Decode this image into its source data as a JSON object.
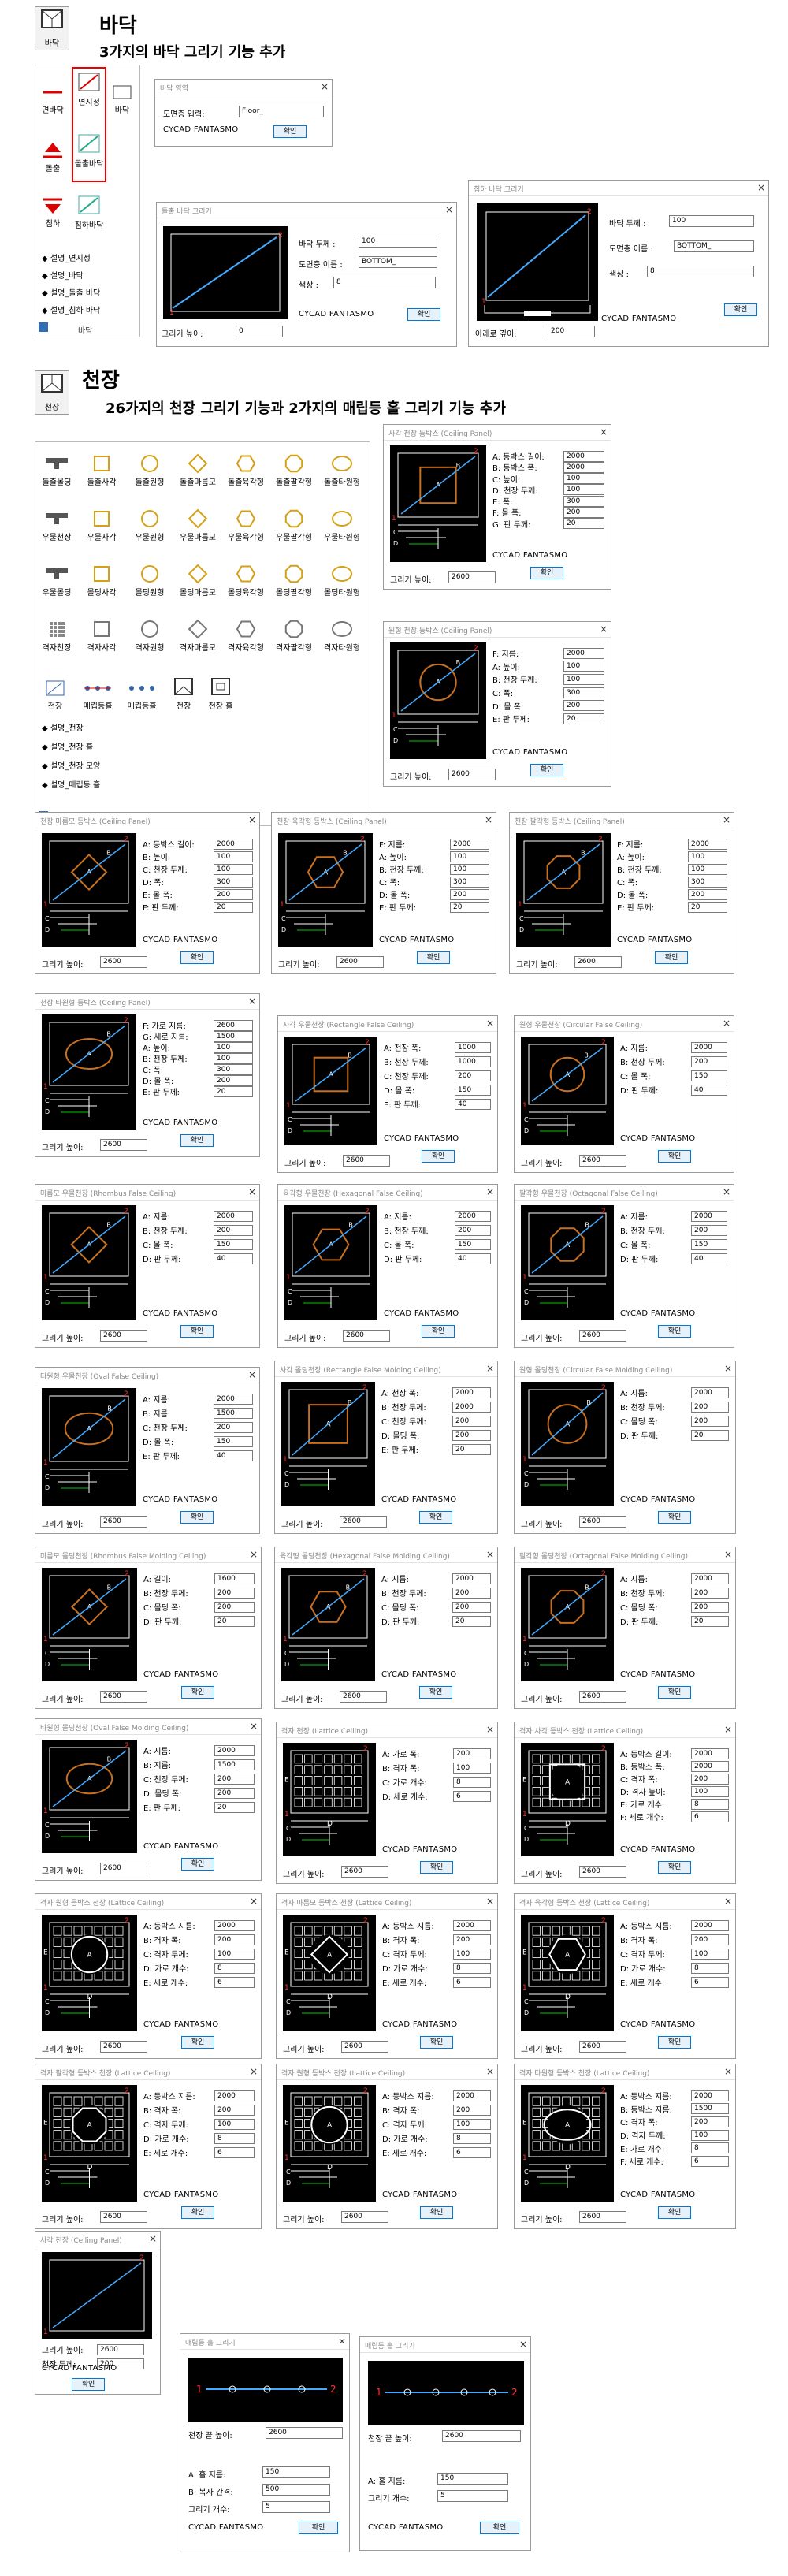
{
  "floor": {
    "icon_label": "바닥",
    "title": "바닥",
    "subtitle": "3가지의 바닥 그리기 기능 추가",
    "tools": [
      {
        "label": "면바닥"
      },
      {
        "label": "면지정"
      },
      {
        "label": "바닥"
      },
      {
        "label": "돌출"
      },
      {
        "label": "돌출바닥"
      },
      {
        "label": "침하"
      },
      {
        "label": "침하바닥"
      }
    ],
    "menu": [
      "설명_면지정",
      "설명_바닥",
      "설명_돌출 바닥",
      "설명_침하 바닥"
    ],
    "footer": "바닥",
    "dialog_small": {
      "title": "바닥 영역",
      "field_label": "도면층 입력:",
      "field_value": "Floor_",
      "brand": "CYCAD FANTASMO",
      "ok": "확인"
    },
    "dialog_raised": {
      "title": "돌출 바닥 그리기",
      "fields": [
        {
          "label": "바닥 두께 :",
          "value": "100"
        },
        {
          "label": "도면층 이름 :",
          "value": "BOTTOM_"
        },
        {
          "label": "색상 :",
          "value": "8"
        }
      ],
      "height_label": "그리기 높이:",
      "height_value": "0",
      "brand": "CYCAD FANTASMO",
      "ok": "확인"
    },
    "dialog_sunken": {
      "title": "침하 바닥 그리기",
      "fields": [
        {
          "label": "바닥 두께 :",
          "value": "100"
        },
        {
          "label": "도면층 이름 :",
          "value": "BOTTOM_"
        },
        {
          "label": "색상 :",
          "value": "8"
        }
      ],
      "height_label": "아래로 깊이:",
      "height_value": "200",
      "brand": "CYCAD FANTASMO",
      "ok": "확인"
    }
  },
  "ceiling": {
    "icon_label": "천장",
    "title": "천장",
    "subtitle": "26가지의 천장 그리기 기능과 2가지의 매립등 홀 그리기 기능 추가",
    "rows": [
      {
        "first": "돌출몰딩",
        "items": [
          "돌출사각",
          "돌출원형",
          "돌출마름모",
          "돌출육각형",
          "돌출팔각형",
          "돌출타원형"
        ]
      },
      {
        "first": "우물천장",
        "items": [
          "우물사각",
          "우물원형",
          "우물마름모",
          "우물육각형",
          "우물팔각형",
          "우물타원형"
        ]
      },
      {
        "first": "우물몰딩",
        "items": [
          "몰딩사각",
          "몰딩원형",
          "몰딩마름모",
          "몰딩육각형",
          "몰딩팔각형",
          "몰딩타원형"
        ]
      },
      {
        "first": "격자천장",
        "items": [
          "격자사각",
          "격자원형",
          "격자마름모",
          "격자육각형",
          "격자팔각형",
          "격자타원형"
        ]
      }
    ],
    "extra": [
      "천장",
      "매립등홀",
      "매립등홀",
      "천장",
      "천장 홀"
    ],
    "menu": [
      "설명_천장",
      "설명_천장 홀",
      "설명_천장 모양",
      "설명_매립등 홀"
    ],
    "footer": "천장"
  },
  "dialogs": [
    {
      "title": "사각 천장 등박스 (Ceiling Panel)",
      "fields": [
        [
          "A: 등박스 길이:",
          "2000"
        ],
        [
          "B: 등박스 폭:",
          "2000"
        ],
        [
          "C: 높이:",
          "100"
        ],
        [
          "D: 천장 두께:",
          "100"
        ],
        [
          "E: 폭:",
          "300"
        ],
        [
          "F: 몰 폭:",
          "200"
        ],
        [
          "G: 판 두께:",
          "20"
        ]
      ],
      "height": "2600"
    },
    {
      "title": "원형 천장 등박스 (Ceiling Panel)",
      "fields": [
        [
          "F: 지름:",
          "2000"
        ],
        [
          "A: 높이:",
          "100"
        ],
        [
          "B: 천장 두께:",
          "100"
        ],
        [
          "C: 폭:",
          "300"
        ],
        [
          "D: 몰 폭:",
          "200"
        ],
        [
          "E: 판 두께:",
          "20"
        ]
      ],
      "height": "2600"
    },
    {
      "title": "천장 마름모 등박스 (Ceiling Panel)",
      "fields": [
        [
          "A: 등박스 길이:",
          "2000"
        ],
        [
          "B: 높이:",
          "100"
        ],
        [
          "C: 천장 두께:",
          "100"
        ],
        [
          "D: 폭:",
          "300"
        ],
        [
          "E: 몰 폭:",
          "200"
        ],
        [
          "F: 판 두께:",
          "20"
        ]
      ],
      "height": "2600"
    },
    {
      "title": "천장 육각형 등박스 (Ceiling Panel)",
      "fields": [
        [
          "F: 지름:",
          "2000"
        ],
        [
          "A: 높이:",
          "100"
        ],
        [
          "B: 천장 두께:",
          "100"
        ],
        [
          "C: 폭:",
          "300"
        ],
        [
          "D: 몰 폭:",
          "200"
        ],
        [
          "E: 판 두께:",
          "20"
        ]
      ],
      "height": "2600"
    },
    {
      "title": "천장 팔각형 등박스 (Ceiling Panel)",
      "fields": [
        [
          "F: 지름:",
          "2000"
        ],
        [
          "A: 높이:",
          "100"
        ],
        [
          "B: 천장 두께:",
          "100"
        ],
        [
          "C: 폭:",
          "300"
        ],
        [
          "D: 몰 폭:",
          "200"
        ],
        [
          "E: 판 두께:",
          "20"
        ]
      ],
      "height": "2600"
    },
    {
      "title": "천장 타원형 등박스 (Ceiling Panel)",
      "fields": [
        [
          "F: 가로 지름:",
          "2600"
        ],
        [
          "G: 세로 지름:",
          "1500"
        ],
        [
          "A: 높이:",
          "100"
        ],
        [
          "B: 천장 두께:",
          "100"
        ],
        [
          "C: 폭:",
          "300"
        ],
        [
          "D: 몰 폭:",
          "200"
        ],
        [
          "E: 판 두께:",
          "20"
        ]
      ],
      "height": "2600"
    },
    {
      "title": "사각 우물천장 (Rectangle False Ceiling)",
      "fields": [
        [
          "A: 천장 폭:",
          "1000"
        ],
        [
          "B: 천장 두께:",
          "1000"
        ],
        [
          "C: 천장 두께:",
          "200"
        ],
        [
          "D: 몰 폭:",
          "150"
        ],
        [
          "E: 판 두께:",
          "40"
        ]
      ],
      "height": "2600"
    },
    {
      "title": "원형 우물천장 (Circular False Ceiling)",
      "fields": [
        [
          "A: 지름:",
          "2000"
        ],
        [
          "B: 천장 두께:",
          "200"
        ],
        [
          "C: 몰 폭:",
          "150"
        ],
        [
          "D: 판 두께:",
          "40"
        ]
      ],
      "height": "2600"
    },
    {
      "title": "마름모 우물천장 (Rhombus False Ceiling)",
      "fields": [
        [
          "A: 지름:",
          "2000"
        ],
        [
          "B: 천장 두께:",
          "200"
        ],
        [
          "C: 몰 폭:",
          "150"
        ],
        [
          "D: 판 두께:",
          "40"
        ]
      ],
      "height": "2600"
    },
    {
      "title": "육각형 우물천장 (Hexagonal False Ceiling)",
      "fields": [
        [
          "A: 지름:",
          "2000"
        ],
        [
          "B: 천장 두께:",
          "200"
        ],
        [
          "C: 몰 폭:",
          "150"
        ],
        [
          "D: 판 두께:",
          "40"
        ]
      ],
      "height": "2600"
    },
    {
      "title": "팔각형 우물천장 (Octagonal False Ceiling)",
      "fields": [
        [
          "A: 지름:",
          "2000"
        ],
        [
          "B: 천장 두께:",
          "200"
        ],
        [
          "C: 몰 폭:",
          "150"
        ],
        [
          "D: 판 두께:",
          "40"
        ]
      ],
      "height": "2600"
    },
    {
      "title": "타원형 우물천장 (Oval False Ceiling)",
      "fields": [
        [
          "A: 지름:",
          "2000"
        ],
        [
          "B: 지름:",
          "1500"
        ],
        [
          "C: 천장 두께:",
          "200"
        ],
        [
          "D: 몰 폭:",
          "150"
        ],
        [
          "E: 판 두께:",
          "40"
        ]
      ],
      "height": "2600"
    },
    {
      "title": "사각 몰딩천장 (Rectangle False Molding Ceiling)",
      "fields": [
        [
          "A: 천장 폭:",
          "2000"
        ],
        [
          "B: 천장 두께:",
          "2000"
        ],
        [
          "C: 천장 두께:",
          "200"
        ],
        [
          "D: 몰딩 폭:",
          "200"
        ],
        [
          "E: 판 두께:",
          "20"
        ]
      ],
      "height": "2600"
    },
    {
      "title": "원형 몰딩천장 (Circular False Molding Ceiling)",
      "fields": [
        [
          "A: 지름:",
          "2000"
        ],
        [
          "B: 천장 두께:",
          "200"
        ],
        [
          "C: 몰딩 폭:",
          "200"
        ],
        [
          "D: 판 두께:",
          "20"
        ]
      ],
      "height": "2600"
    },
    {
      "title": "마름모 몰딩천장 (Rhombus False Molding Ceiling)",
      "fields": [
        [
          "A: 길이:",
          "1600"
        ],
        [
          "B: 천장 두께:",
          "200"
        ],
        [
          "C: 몰딩 폭:",
          "200"
        ],
        [
          "D: 판 두께:",
          "20"
        ]
      ],
      "height": "2600"
    },
    {
      "title": "육각형 몰딩천장 (Hexagonal False Molding Ceiling)",
      "fields": [
        [
          "A: 지름:",
          "2000"
        ],
        [
          "B: 천장 두께:",
          "200"
        ],
        [
          "C: 몰딩 폭:",
          "200"
        ],
        [
          "D: 판 두께:",
          "20"
        ]
      ],
      "height": "2600"
    },
    {
      "title": "팔각형 몰딩천장 (Octagonal False Molding Ceiling)",
      "fields": [
        [
          "A: 지름:",
          "2000"
        ],
        [
          "B: 천장 두께:",
          "200"
        ],
        [
          "C: 몰딩 폭:",
          "200"
        ],
        [
          "D: 판 두께:",
          "20"
        ]
      ],
      "height": "2600"
    },
    {
      "title": "타원형 몰딩천장 (Oval False Molding Ceiling)",
      "fields": [
        [
          "A: 지름:",
          "2000"
        ],
        [
          "B: 지름:",
          "1500"
        ],
        [
          "C: 천장 두께:",
          "200"
        ],
        [
          "D: 몰딩 폭:",
          "200"
        ],
        [
          "E: 판 두께:",
          "20"
        ]
      ],
      "height": "2600"
    },
    {
      "title": "격자 천장 (Lattice Ceiling)",
      "fields": [
        [
          "A: 가로 폭:",
          "200"
        ],
        [
          "B: 격자 폭:",
          "100"
        ],
        [
          "C: 가로 개수:",
          "8"
        ],
        [
          "D: 세로 개수:",
          "6"
        ]
      ],
      "height": "2600"
    },
    {
      "title": "격자 사각 등박스 천장 (Lattice Ceiling)",
      "fields": [
        [
          "A: 등박스 길이:",
          "2000"
        ],
        [
          "B: 등박스 폭:",
          "2000"
        ],
        [
          "C: 격자 폭:",
          "200"
        ],
        [
          "D: 격자 높이:",
          "100"
        ],
        [
          "E: 가로 개수:",
          "8"
        ],
        [
          "F: 세로 개수:",
          "6"
        ]
      ],
      "height": "2600"
    },
    {
      "title": "격자 원형 등박스 천장 (Lattice Ceiling)",
      "fields": [
        [
          "A: 등박스 지름:",
          "2000"
        ],
        [
          "B: 격자 폭:",
          "200"
        ],
        [
          "C: 격자 두께:",
          "100"
        ],
        [
          "D: 가로 개수:",
          "8"
        ],
        [
          "E: 세로 개수:",
          "6"
        ]
      ],
      "height": "2600"
    },
    {
      "title": "격자 마름모 등박스 천장 (Lattice Ceiling)",
      "fields": [
        [
          "A: 등박스 지름:",
          "2000"
        ],
        [
          "B: 격자 폭:",
          "200"
        ],
        [
          "C: 격자 두께:",
          "100"
        ],
        [
          "D: 가로 개수:",
          "8"
        ],
        [
          "E: 세로 개수:",
          "6"
        ]
      ],
      "height": "2600"
    },
    {
      "title": "격자 육각형 등박스 천장 (Lattice Ceiling)",
      "fields": [
        [
          "A: 등박스 지름:",
          "2000"
        ],
        [
          "B: 격자 폭:",
          "200"
        ],
        [
          "C: 격자 두께:",
          "100"
        ],
        [
          "D: 가로 개수:",
          "8"
        ],
        [
          "E: 세로 개수:",
          "6"
        ]
      ],
      "height": "2600"
    },
    {
      "title": "격자 팔각형 등박스 천장 (Lattice Ceiling)",
      "fields": [
        [
          "A: 등박스 지름:",
          "2000"
        ],
        [
          "B: 격자 폭:",
          "200"
        ],
        [
          "C: 격자 두께:",
          "100"
        ],
        [
          "D: 가로 개수:",
          "8"
        ],
        [
          "E: 세로 개수:",
          "6"
        ]
      ],
      "height": "2600"
    },
    {
      "title": "격자 원형 등박스 천장 (Lattice Ceiling)",
      "fields": [
        [
          "A: 등박스 지름:",
          "2000"
        ],
        [
          "B: 격자 폭:",
          "200"
        ],
        [
          "C: 격자 두께:",
          "100"
        ],
        [
          "D: 가로 개수:",
          "8"
        ],
        [
          "E: 세로 개수:",
          "6"
        ]
      ],
      "height": "2600"
    },
    {
      "title": "격자 타원형 등박스 천장 (Lattice Ceiling)",
      "fields": [
        [
          "A: 등박스 지름:",
          "2000"
        ],
        [
          "B: 등박스 지름:",
          "1500"
        ],
        [
          "C: 격자 폭:",
          "200"
        ],
        [
          "D: 격자 두께:",
          "100"
        ],
        [
          "E: 가로 개수:",
          "8"
        ],
        [
          "F: 세로 개수:",
          "6"
        ]
      ],
      "height": "2600"
    },
    {
      "title": "사각 천장 (Ceiling Panel)",
      "fields": [
        [
          "그리기 높이:",
          "2600"
        ],
        [
          "천장 두께:",
          "200"
        ]
      ],
      "height": ""
    }
  ],
  "dialog_common": {
    "height_label": "그리기 높이:",
    "brand": "CYCAD FANTASMO",
    "ok": "확인"
  },
  "lamp_a": {
    "title": "매립등 홀 그리기",
    "height_label": "천장 끝 높이:",
    "height_value": "2600",
    "fields": [
      [
        "A: 홀 지름:",
        "150"
      ],
      [
        "B: 복사 간격:",
        "500"
      ],
      [
        "그리기 개수:",
        "5"
      ]
    ],
    "brand": "CYCAD FANTASMO",
    "ok": "확인"
  },
  "lamp_b": {
    "title": "매립등 홀 그리기",
    "height_label": "천장 끝 높이:",
    "height_value": "2600",
    "fields": [
      [
        "A: 홀 지름:",
        "150"
      ],
      [
        "그리기 개수:",
        "5"
      ]
    ],
    "brand": "CYCAD FANTASMO",
    "ok": "확인"
  }
}
